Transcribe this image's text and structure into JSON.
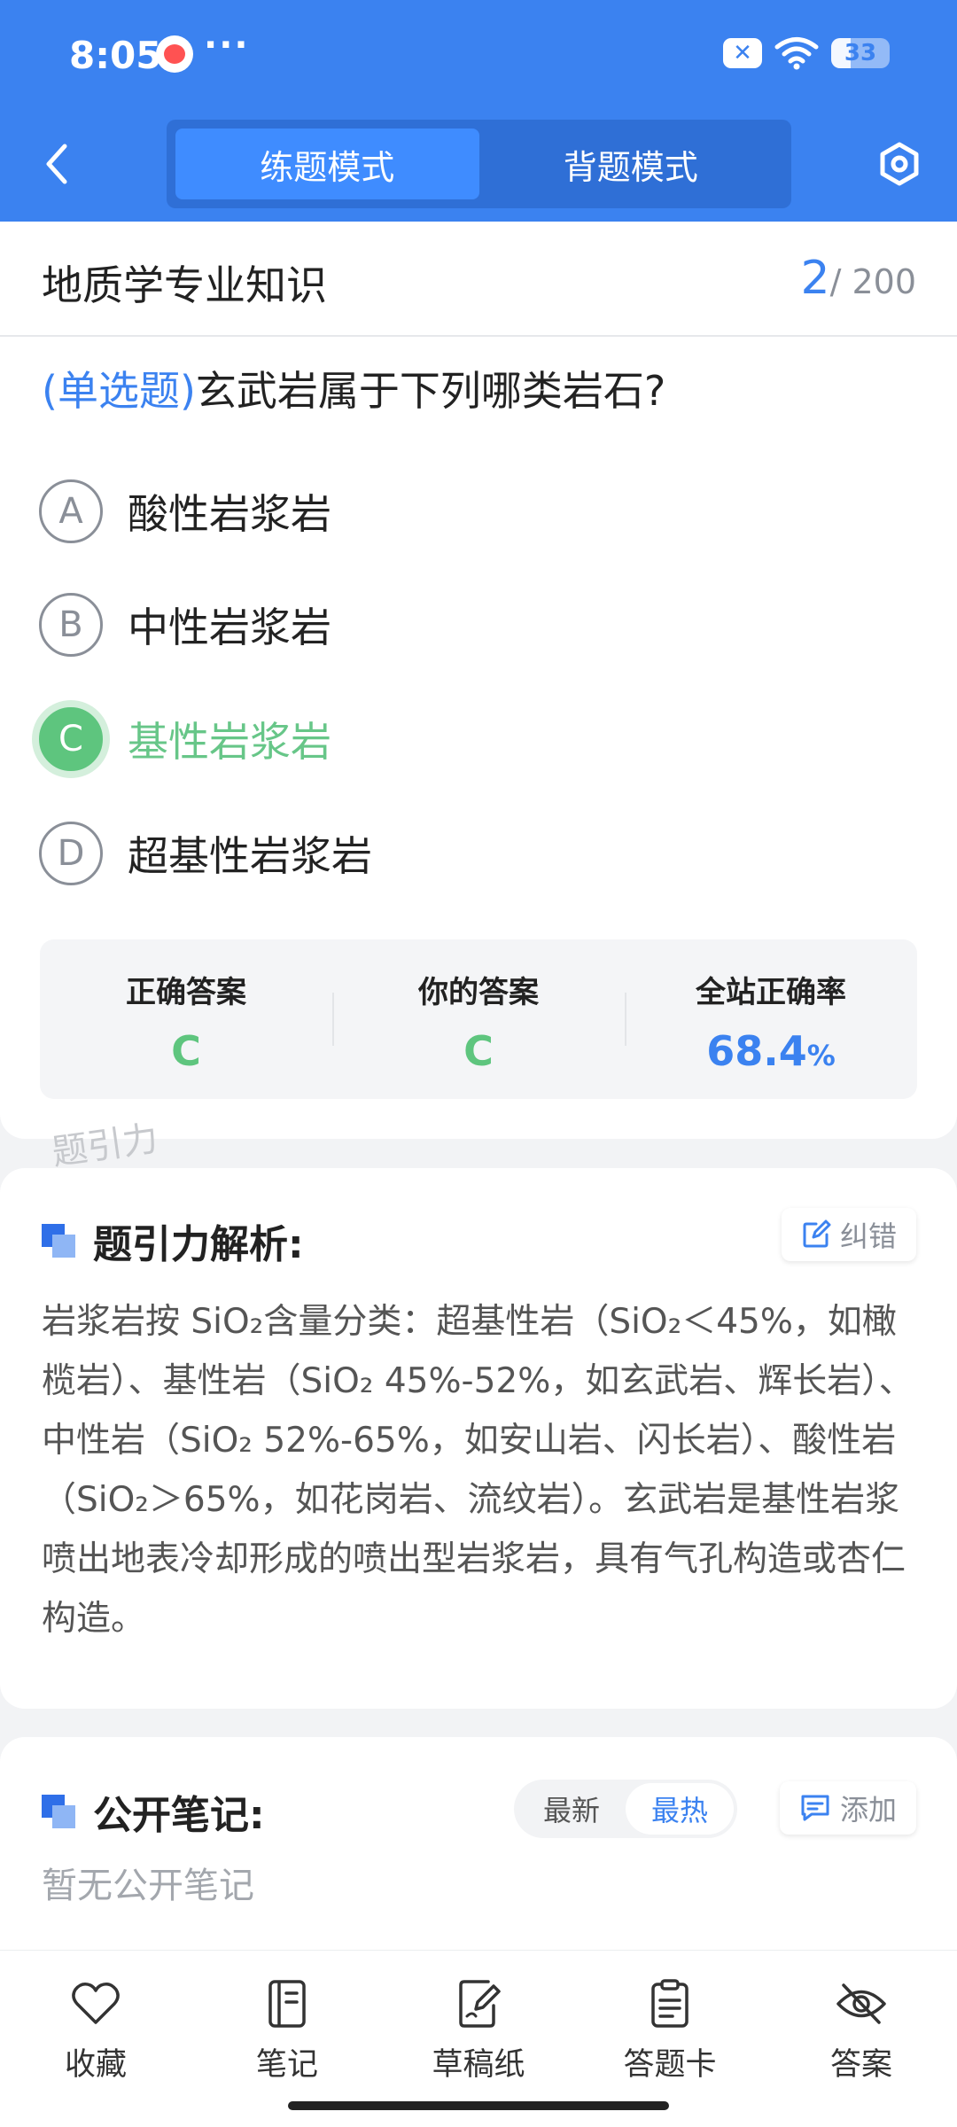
{
  "status_bar": {
    "time": "8:05",
    "more": "···",
    "battery": "33",
    "battery_level": 0.33
  },
  "header": {
    "tabs": [
      {
        "label": "练题模式",
        "active": true
      },
      {
        "label": "背题模式",
        "active": false
      }
    ],
    "icons": {
      "back": "chevron-left-icon",
      "settings": "hexagon-settings-icon"
    }
  },
  "question": {
    "subject": "地质学专业知识",
    "current": "2",
    "total": "/ 200",
    "type_label": "(单选题)",
    "text": "玄武岩属于下列哪类岩石?",
    "options": [
      {
        "letter": "A",
        "text": "酸性岩浆岩"
      },
      {
        "letter": "B",
        "text": "中性岩浆岩"
      },
      {
        "letter": "C",
        "text": "基性岩浆岩",
        "state": "correct"
      },
      {
        "letter": "D",
        "text": "超基性岩浆岩"
      }
    ]
  },
  "answer_summary": {
    "correct_label": "正确答案",
    "correct_value": "C",
    "yours_label": "你的答案",
    "yours_value": "C",
    "rate_label": "全站正确率",
    "rate_value": "68.4",
    "rate_unit": "%"
  },
  "watermark": "题引力",
  "explanation": {
    "title": "题引力解析:",
    "correct_button": "纠错",
    "text": "岩浆岩按 SiO₂含量分类：超基性岩（SiO₂＜45%，如橄榄岩）、基性岩（SiO₂ 45%-52%，如玄武岩、辉长岩）、中性岩（SiO₂ 52%-65%，如安山岩、闪长岩）、酸性岩（SiO₂＞65%，如花岗岩、流纹岩）。玄武岩是基性岩浆喷出地表冷却形成的喷出型岩浆岩，具有气孔构造或杏仁构造。"
  },
  "notes": {
    "title": "公开笔记:",
    "sort_newest": "最新",
    "sort_hottest": "最热",
    "add_button": "添加",
    "empty_text": "暂无公开笔记"
  },
  "bottom_nav": [
    {
      "label": "收藏",
      "icon": "heart-icon"
    },
    {
      "label": "笔记",
      "icon": "notebook-icon"
    },
    {
      "label": "草稿纸",
      "icon": "draft-paper-icon"
    },
    {
      "label": "答题卡",
      "icon": "answer-sheet-icon"
    },
    {
      "label": "答案",
      "icon": "eye-off-icon"
    }
  ],
  "colors": {
    "primary": "#3b82f0",
    "correct_green": "#5ec57e",
    "text_dark": "#222222",
    "text_muted": "#8a8f98"
  }
}
